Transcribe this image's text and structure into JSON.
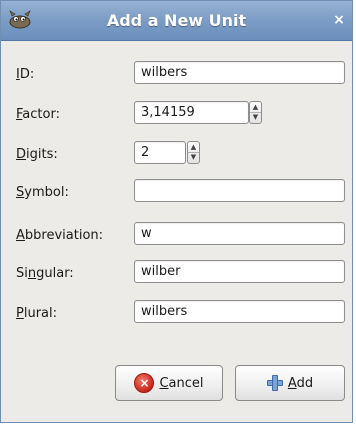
{
  "window": {
    "title": "Add a New Unit",
    "close_label": "×",
    "app_icon": "gimp-wilber-icon"
  },
  "form": {
    "id": {
      "label_first": "I",
      "label_rest": "D:",
      "value": "wilbers"
    },
    "factor": {
      "label_first": "F",
      "label_rest": "actor:",
      "value": "3,14159"
    },
    "digits": {
      "label_first": "D",
      "label_rest": "igits:",
      "value": "2"
    },
    "symbol": {
      "label_first": "S",
      "label_rest": "ymbol:",
      "value": ""
    },
    "abbreviation": {
      "label_first": "A",
      "label_rest": "bbreviation:",
      "value": "w"
    },
    "singular": {
      "label_pre": "Si",
      "label_mid": "n",
      "label_rest": "gular:",
      "value": "wilber"
    },
    "plural": {
      "label_first": "P",
      "label_rest": "lural:",
      "value": "wilbers"
    }
  },
  "buttons": {
    "cancel": {
      "label_first": "C",
      "label_rest": "ancel",
      "icon": "cancel-icon"
    },
    "add": {
      "label_first": "A",
      "label_rest": "dd",
      "icon": "add-icon"
    }
  },
  "colors": {
    "titlebar": "#7b9cc5",
    "window_bg": "#edebe8",
    "cancel_icon": "#c8261a",
    "add_icon": "#7aa4d8"
  }
}
